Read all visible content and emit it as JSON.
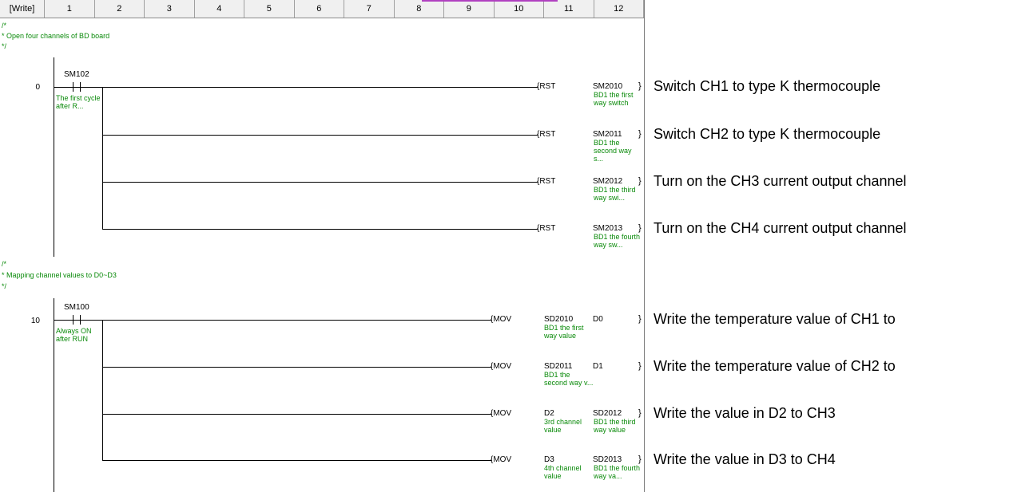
{
  "header": {
    "mode_label": "[Write]",
    "columns": [
      "1",
      "2",
      "3",
      "4",
      "5",
      "6",
      "7",
      "8",
      "9",
      "10",
      "11",
      "12"
    ]
  },
  "block1": {
    "comment_open": "/*",
    "comment_text": "* Open four channels of BD board",
    "comment_close": "*/",
    "step": "0",
    "contact": {
      "device": "SM102",
      "comment": "The first cycle after R..."
    },
    "rungs": [
      {
        "instr": "{RST",
        "operand": "SM2010",
        "comment": "BD1 the first way switch",
        "close": "}"
      },
      {
        "instr": "{RST",
        "operand": "SM2011",
        "comment": "BD1 the second way s...",
        "close": "}"
      },
      {
        "instr": "{RST",
        "operand": "SM2012",
        "comment": "BD1 the third way swi...",
        "close": "}"
      },
      {
        "instr": "{RST",
        "operand": "SM2013",
        "comment": "BD1 the fourth way sw...",
        "close": "}"
      }
    ]
  },
  "block2": {
    "comment_open": "/*",
    "comment_text": "* Mapping channel values to D0~D3",
    "comment_close": "*/",
    "step": "10",
    "contact": {
      "device": "SM100",
      "comment": "Always ON after RUN"
    },
    "rungs": [
      {
        "instr": "{MOV",
        "op1": "SD2010",
        "op1_comment": "BD1 the first way value",
        "op2": "D0",
        "op2_comment": "",
        "close": "}"
      },
      {
        "instr": "{MOV",
        "op1": "SD2011",
        "op1_comment": "BD1 the second way v...",
        "op2": "D1",
        "op2_comment": "",
        "close": "}"
      },
      {
        "instr": "{MOV",
        "op1": "D2",
        "op1_comment": "3rd channel value",
        "op2": "SD2012",
        "op2_comment": "BD1 the third way value",
        "close": "}"
      },
      {
        "instr": "{MOV",
        "op1": "D3",
        "op1_comment": "4th channel value",
        "op2": "SD2013",
        "op2_comment": "BD1 the fourth way va...",
        "close": "}"
      }
    ]
  },
  "annotations": [
    "Switch CH1 to type K thermocouple",
    "Switch CH2 to type K thermocouple",
    "Turn on the CH3 current output channel",
    "Turn on the CH4 current output channel",
    "Write the temperature value of CH1 to",
    "Write the temperature value of CH2 to",
    "Write the value in D2 to CH3",
    "Write the value in D3 to CH4"
  ],
  "colors": {
    "comment_green": "#0a8a0a",
    "header_bg": "#f0f0f0",
    "link_purple": "#b040c0"
  }
}
